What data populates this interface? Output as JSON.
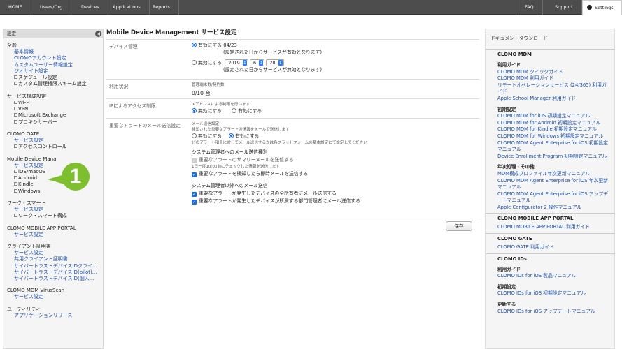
{
  "topnav": {
    "items": [
      "HOME",
      "Users/Org",
      "Devices",
      "Applications",
      "Reports"
    ],
    "right_items": [
      "FAQ",
      "Support"
    ],
    "settings_label": "Settings"
  },
  "sidebar": {
    "header": "設定",
    "sections": [
      {
        "title": "全般",
        "items": [
          {
            "t": "link",
            "label": "基本情報"
          },
          {
            "t": "link",
            "label": "CLOMOアカウント設定"
          },
          {
            "t": "link",
            "label": "カスタムユーザー情報設定"
          },
          {
            "t": "link",
            "label": "ジオサイト設定"
          },
          {
            "t": "exp",
            "label": "スケジュール設定"
          },
          {
            "t": "exp",
            "label": "カスタム管理権限スキーム設定"
          }
        ]
      },
      {
        "title": "サービス構成設定",
        "items": [
          {
            "t": "exp",
            "label": "Wi-Fi"
          },
          {
            "t": "exp",
            "label": "VPN"
          },
          {
            "t": "exp",
            "label": "Microsoft Exchange"
          },
          {
            "t": "exp",
            "label": "プロキシサーバー"
          }
        ]
      },
      {
        "title": "CLOMO GATE",
        "items": [
          {
            "t": "link",
            "label": "サービス設定"
          },
          {
            "t": "exp",
            "label": "アクセスコントロール"
          }
        ]
      },
      {
        "title": "Mobile Device Mana",
        "items": [
          {
            "t": "link",
            "label": "サービス設定"
          },
          {
            "t": "exp",
            "label": "iOS/macOS"
          },
          {
            "t": "exp",
            "label": "Android"
          },
          {
            "t": "exp",
            "label": "Kindle"
          },
          {
            "t": "exp",
            "label": "Windows"
          }
        ]
      },
      {
        "title": "ワーク・スマート",
        "items": [
          {
            "t": "link",
            "label": "サービス設定"
          },
          {
            "t": "exp",
            "label": "ワーク・スマート構成"
          }
        ]
      },
      {
        "title": "CLOMO MOBILE APP PORTAL",
        "items": [
          {
            "t": "link",
            "label": "サービス設定"
          }
        ]
      },
      {
        "title": "クライアント証明書",
        "items": [
          {
            "t": "link",
            "label": "サービス設定"
          },
          {
            "t": "link",
            "label": "共用クライアント証明書"
          },
          {
            "t": "link",
            "label": "サイバートラストデバイスIDクライ..."
          },
          {
            "t": "link",
            "label": "サイバートラストデバイスID(pilot)..."
          },
          {
            "t": "link",
            "label": "サイバートラストデバイスID(個人..."
          }
        ]
      },
      {
        "title": "CLOMO MDM VirusScan",
        "items": [
          {
            "t": "link",
            "label": "サービス設定"
          }
        ]
      },
      {
        "title": "ユーティリティ",
        "items": [
          {
            "t": "link",
            "label": "アプリケーションリリース"
          }
        ]
      }
    ]
  },
  "callout": {
    "number": "1"
  },
  "main": {
    "title": "Mobile Device Management サービス設定",
    "device_mgmt": {
      "label": "デバイス管理",
      "enable_label": "有効にする 04/23",
      "enable_note": "(設定された日からサービスが有効となります)",
      "disable_label": "無効にする",
      "year": "2019",
      "month": "6",
      "day": "28",
      "disable_note": "(設定された日からサービスが無効となります)"
    },
    "usage": {
      "label": "利用状況",
      "sublabel": "管理端末数/契約数",
      "value": "0/10 台"
    },
    "ip": {
      "label": "IPによるアクセス制限",
      "desc": "IPアドレスによる制限を行います",
      "disable": "無効にする",
      "enable": "有効にする"
    },
    "alert": {
      "label": "重要なアラートのメール送信設定",
      "heading": "メール送信設定",
      "desc": "検知された重要なアラートの情報をメールで送信します",
      "disable": "無効にする",
      "enable": "有効にする",
      "note": "どのアラート項目に対してメール送信するかは各プラットフォームの基本設定にて設定してください",
      "admin_title": "システム管理者へのメール送信種別",
      "summary_label": "重要なアラートのサマリーメールを送信する",
      "summary_note": "1日一度10:00前にチェックした情報を送信します",
      "immediate_label": "重要なアラートを検知したら即時メールを送信する",
      "other_title": "システム管理者以外へのメール送信",
      "owner_label": "重要なアラートが発生したデバイスの全所有者にメール送信する",
      "dept_label": "重要なアラートが発生したデバイスが所属する部門管理者にメール送信する"
    },
    "save_label": "保存"
  },
  "docs": {
    "title": "ドキュメントダウンロード",
    "blocks": [
      {
        "heading": "CLOMO MDM",
        "groups": [
          {
            "sub": "利用ガイド",
            "links": [
              "CLOMO MDM クイックガイド",
              "CLOMO MDM 利用ガイド",
              "リモートオペレーションサービス (24/365) 利用ガイド",
              "Apple School Manager 利用ガイド"
            ]
          },
          {
            "sub": "初期設定",
            "links": [
              "CLOMO MDM for iOS 初期設定マニュアル",
              "CLOMO MDM for Android 初期設定マニュアル",
              "CLOMO MDM for Kindle 初期設定マニュアル",
              "CLOMO MDM for Windows 初期設定マニュアル",
              "CLOMO MDM Agent Enterprise for iOS 初期設定マニュアル",
              "Device Enrollment Program 初期設定マニュアル"
            ]
          },
          {
            "sub": "年次処理・その他",
            "links": [
              "MDM構成プロファイル年次更新マニュアル",
              "CLOMO MDM Agent Enterprise for iOS 年次更新マニュアル",
              "CLOMO MDM Agent Enterprise for iOS アップデートマニュアル",
              "Apple Configurator 2 操作マニュアル"
            ]
          }
        ]
      },
      {
        "heading": "CLOMO MOBILE APP PORTAL",
        "groups": [
          {
            "sub": "",
            "links": [
              "CLOMO MOBILE APP PORTAL 利用ガイド"
            ]
          }
        ]
      },
      {
        "heading": "CLOMO GATE",
        "groups": [
          {
            "sub": "",
            "links": [
              "CLOMO GATE 利用ガイド"
            ]
          }
        ]
      },
      {
        "heading": "CLOMO IDs",
        "groups": [
          {
            "sub": "利用ガイド",
            "links": [
              "CLOMO IDs for iOS 製品マニュアル"
            ]
          },
          {
            "sub": "初期設定",
            "links": [
              "CLOMO IDs for iOS 初期設定マニュアル"
            ]
          },
          {
            "sub": "更新する",
            "links": [
              "CLOMO IDs for iOS アップデートマニュアル"
            ]
          }
        ]
      }
    ]
  }
}
